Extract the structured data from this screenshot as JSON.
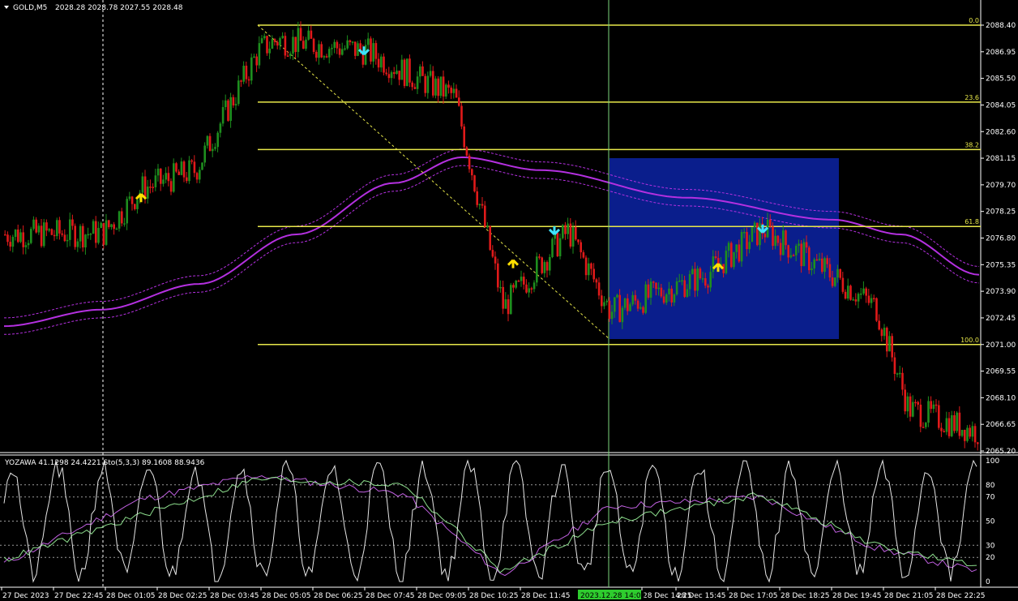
{
  "main_chart": {
    "symbol_label": "GOLD,M5",
    "ohlc_text": "2028.28 2028.78 2027.55 2028.48",
    "price_axis_labels": [
      "2088.40",
      "2086.95",
      "2085.50",
      "2084.05",
      "2082.60",
      "2081.15",
      "2079.70",
      "2078.25",
      "2076.80",
      "2075.35",
      "2073.90",
      "2072.45",
      "2071.00",
      "2069.55",
      "2068.10",
      "2066.65",
      "2065.20"
    ],
    "price_axis_values": [
      2088.4,
      2086.95,
      2085.5,
      2084.05,
      2082.6,
      2081.15,
      2079.7,
      2078.25,
      2076.8,
      2075.35,
      2073.9,
      2072.45,
      2071.0,
      2069.55,
      2068.1,
      2066.65,
      2065.2
    ],
    "fib_levels": [
      {
        "label": "0.0",
        "price": 2088.4
      },
      {
        "label": "23.6",
        "price": 2084.21
      },
      {
        "label": "38.2",
        "price": 2081.62
      },
      {
        "label": "61.8",
        "price": 2077.43
      },
      {
        "label": "100.0",
        "price": 2071.0
      }
    ],
    "highlight_box": {
      "from_time": "28 Dec 14:00",
      "to_time": "28 Dec 18:25",
      "high_price": 2081.15,
      "low_price": 2071.0
    }
  },
  "time_axis": {
    "labels": [
      "27 Dec 2023",
      "27 Dec 22:45",
      "28 Dec 01:05",
      "28 Dec 02:25",
      "28 Dec 03:45",
      "28 Dec 05:05",
      "28 Dec 06:25",
      "28 Dec 07:45",
      "28 Dec 09:05",
      "28 Dec 10:25",
      "28 Dec 11:45",
      "28 Dec 14:25",
      "28 Dec 15:45",
      "28 Dec 17:05",
      "28 Dec 18:25",
      "28 Dec 19:45",
      "28 Dec 21:05",
      "28 Dec 22:25"
    ],
    "crosshair_label": "2023.12.28 14:00"
  },
  "sub_chart": {
    "indicator_text": "YOZAWA 41.1298 24.4221  Sto(5,3,3) 89.1608 88.9436",
    "axis_labels": [
      "100",
      "80",
      "70",
      "50",
      "30",
      "20",
      "0"
    ],
    "axis_values": [
      100,
      80,
      70,
      50,
      30,
      20,
      0
    ]
  },
  "chart_data": [
    {
      "type": "line",
      "title": "GOLD,M5",
      "xlabel": "",
      "ylabel": "",
      "ylim": [
        2065.2,
        2088.4
      ],
      "legend": "none",
      "grid": false,
      "x_range": [
        "27 Dec 2023",
        "28 Dec 22:25"
      ],
      "series": [
        {
          "x": [
            "27 Dec 2023",
            "27 Dec 22:45",
            "28 Dec 01:05",
            "28 Dec 02:25",
            "28 Dec 03:45",
            "28 Dec 05:05",
            "28 Dec 06:25",
            "28 Dec 07:45",
            "28 Dec 09:05",
            "28 Dec 10:25",
            "28 Dec 11:45",
            "28 Dec 14:00",
            "28 Dec 15:45",
            "28 Dec 17:05",
            "28 Dec 18:25",
            "28 Dec 19:45",
            "28 Dec 21:05",
            "28 Dec 22:25"
          ],
          "values": [
            2077.0,
            2077.1,
            2079.5,
            2080.5,
            2087.0,
            2087.6,
            2087.0,
            2085.8,
            2084.5,
            2073.0,
            2077.2,
            2072.8,
            2074.8,
            2077.3,
            2074.5,
            2073.0,
            2067.5,
            2066.2
          ]
        }
      ]
    },
    {
      "type": "line",
      "title": "YOZAWA / Sto(5,3,3)",
      "xlabel": "",
      "ylabel": "",
      "ylim": [
        0,
        100
      ],
      "legend": "none",
      "grid": true,
      "x_range": [
        "27 Dec 2023",
        "28 Dec 22:25"
      ],
      "series": [
        {
          "x": [
            "27 Dec 2023",
            "28 Dec 01:05",
            "28 Dec 03:45",
            "28 Dec 07:45",
            "28 Dec 10:25",
            "28 Dec 14:00",
            "28 Dec 17:05",
            "28 Dec 19:45",
            "28 Dec 22:25"
          ],
          "values": [
            15,
            68,
            88,
            72,
            5,
            62,
            70,
            28,
            8
          ]
        },
        {
          "x": [
            "27 Dec 2023",
            "28 Dec 01:05",
            "28 Dec 03:45",
            "28 Dec 07:45",
            "28 Dec 10:25",
            "28 Dec 14:00",
            "28 Dec 17:05",
            "28 Dec 19:45",
            "28 Dec 22:25"
          ],
          "values": [
            18,
            55,
            85,
            80,
            8,
            50,
            72,
            30,
            12
          ]
        },
        {
          "x": [
            "27 Dec 2023",
            "28 Dec 01:05",
            "28 Dec 03:45",
            "28 Dec 07:45",
            "28 Dec 10:25",
            "28 Dec 14:00",
            "28 Dec 17:05",
            "28 Dec 19:45",
            "28 Dec 22:25"
          ],
          "values": [
            80,
            20,
            95,
            10,
            90,
            0,
            85,
            20,
            25
          ]
        }
      ]
    }
  ],
  "colors": {
    "bull": "#1e8e1e",
    "bear": "#e01a1a",
    "fib": "#e8e84a",
    "ma": "#b430e0",
    "box": "#0a1e8c",
    "up_arrow": "#ffe000",
    "down_arrow": "#3ee3ff",
    "crosshair_label_bg": "#2ecc2e"
  }
}
